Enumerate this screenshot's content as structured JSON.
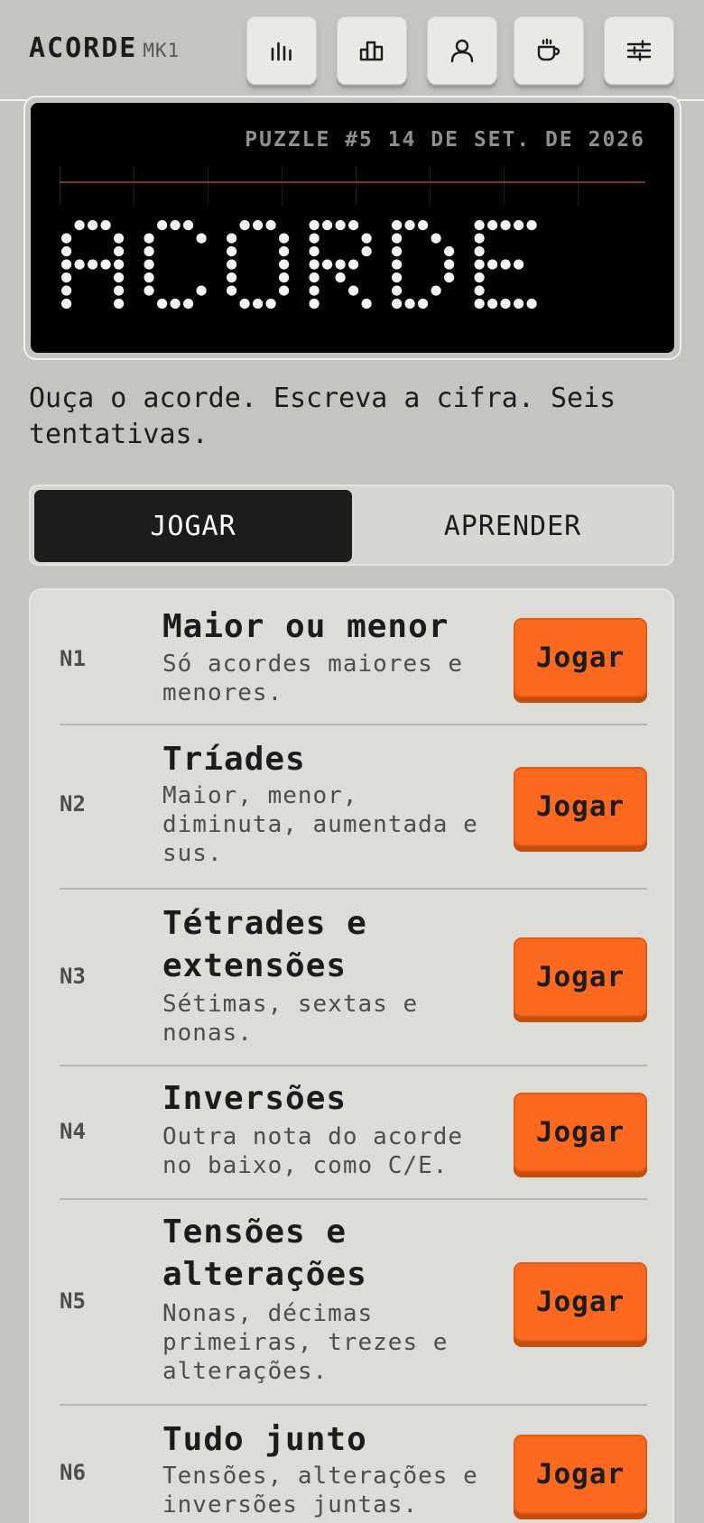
{
  "header": {
    "brand": "ACORDE",
    "brand_suffix": "MK1",
    "buttons": [
      {
        "icon": "sound-bars-icon"
      },
      {
        "icon": "stats-icon"
      },
      {
        "icon": "profile-icon"
      },
      {
        "icon": "coffee-icon"
      },
      {
        "icon": "settings-sliders-icon"
      }
    ]
  },
  "display": {
    "puzzle_label": "PUZZLE #5 14 DE SET. DE 2026",
    "word": "ACORDE"
  },
  "tagline": "Ouça o acorde. Escreva a cifra. Seis tentativas.",
  "tabs": {
    "play": "JOGAR",
    "learn": "APRENDER"
  },
  "levels": [
    {
      "num": "N1",
      "title": "Maior ou menor",
      "desc": "Só acordes maiores e menores.",
      "button": "Jogar"
    },
    {
      "num": "N2",
      "title": "Tríades",
      "desc": "Maior, menor, diminuta, aumentada e sus.",
      "button": "Jogar"
    },
    {
      "num": "N3",
      "title": "Tétrades e extensões",
      "desc": "Sétimas, sextas e nonas.",
      "button": "Jogar"
    },
    {
      "num": "N4",
      "title": "Inversões",
      "desc": "Outra nota do acorde no baixo, como C/E.",
      "button": "Jogar"
    },
    {
      "num": "N5",
      "title": "Tensões e alterações",
      "desc": "Nonas, décimas primeiras, trezes e alterações.",
      "button": "Jogar"
    },
    {
      "num": "N6",
      "title": "Tudo junto",
      "desc": "Tensões, alterações e inversões juntas.",
      "button": "Jogar"
    }
  ],
  "colors": {
    "background": "#c4c5c1",
    "accent": "#fd6a1f",
    "display_bg": "#000000",
    "active_tab": "#1c1c1b"
  }
}
